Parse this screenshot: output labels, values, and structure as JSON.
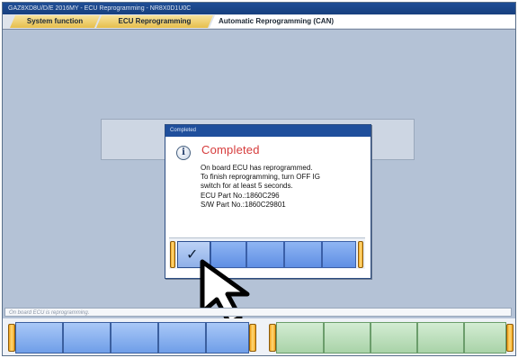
{
  "window": {
    "title": "GAZ8XD8U/D/E 2016MY  -  ECU Reprogramming  -  NR8X0D1U0C"
  },
  "tabs": [
    {
      "label": "System function"
    },
    {
      "label": "ECU Reprogramming"
    },
    {
      "label": "Automatic Reprogramming (CAN)"
    }
  ],
  "dialog": {
    "title": "Completed",
    "heading": "Completed",
    "lines": [
      "On board ECU has reprogrammed.",
      "To finish reprogramming, turn OFF IG",
      "switch for at least 5 seconds.",
      "ECU Part No.:1860C296",
      "S/W Part No.:1860C29801"
    ],
    "ok_icon": "checkmark-icon",
    "ok_symbol": "✓"
  },
  "status_bar": {
    "text": "On board ECU is reprogramming."
  },
  "colors": {
    "accent_blue": "#6f9ee8",
    "accent_green": "#a9d3a8",
    "heading_red": "#d63b3b",
    "tab_gold": "#e6be4b"
  }
}
